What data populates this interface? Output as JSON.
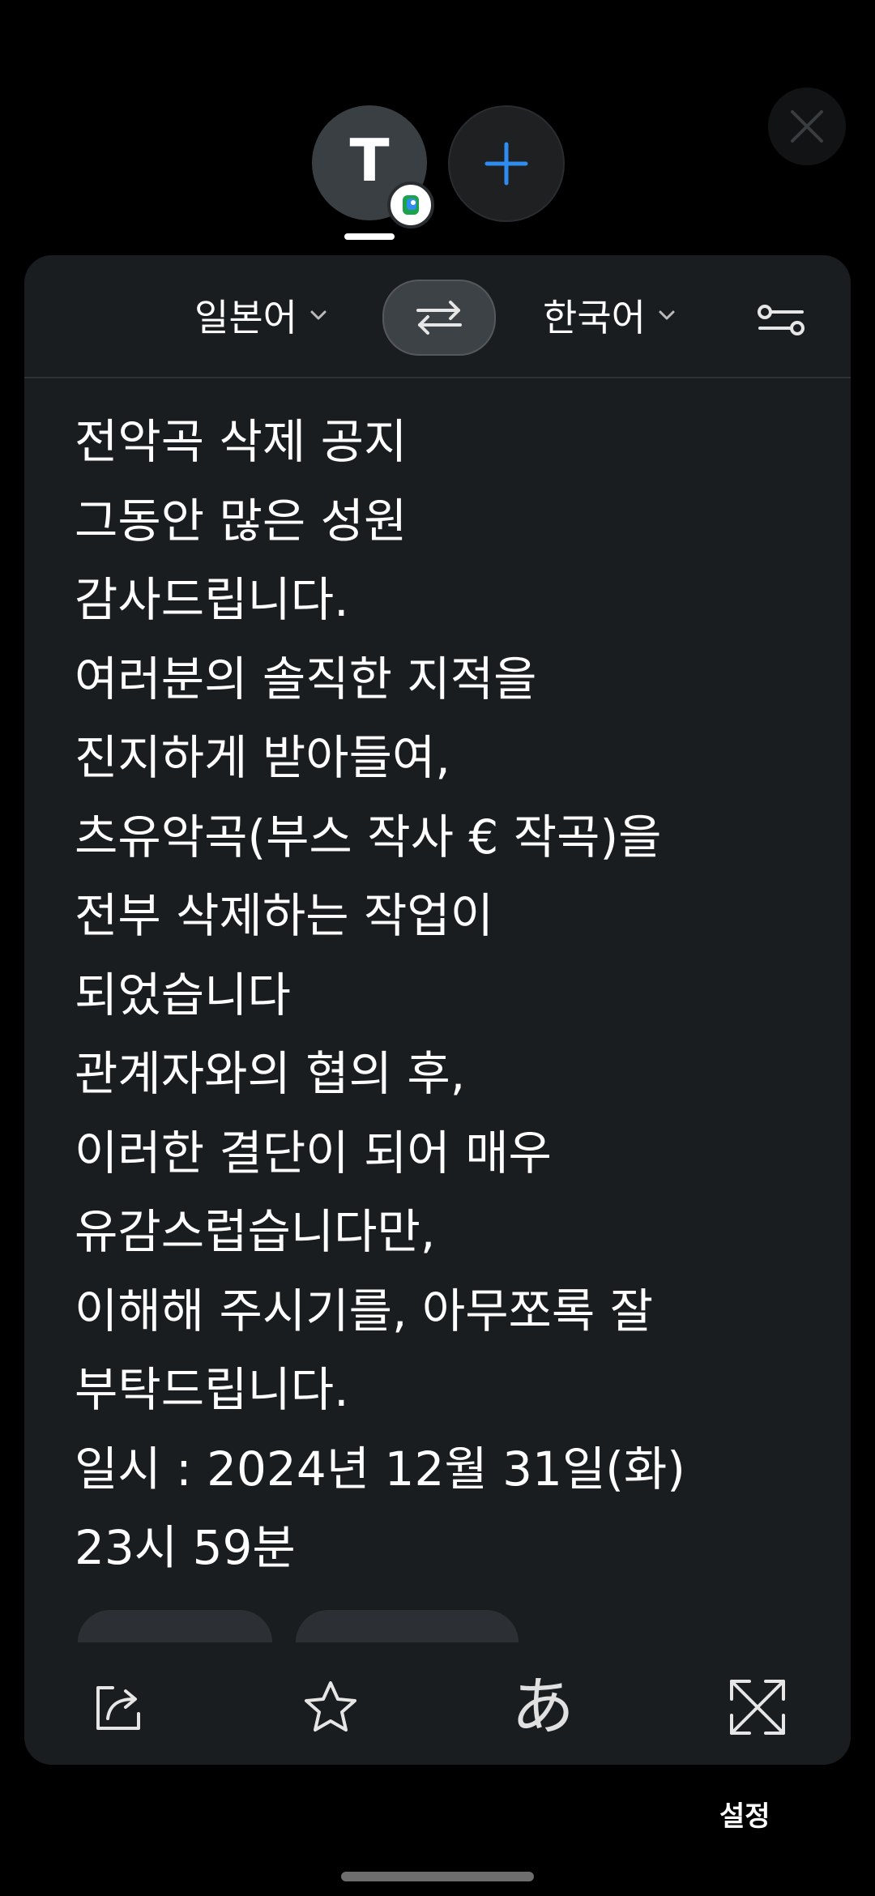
{
  "tabs": {
    "active_letter": "T"
  },
  "language_bar": {
    "source_language": "일본어",
    "target_language": "한국어"
  },
  "translation": {
    "lines": [
      "전악곡 삭제 공지",
      "그동안 많은 성원",
      "감사드립니다.",
      "여러분의 솔직한 지적을",
      "진지하게 받아들여,",
      "츠유악곡(부스 작사 € 작곡)을",
      "전부 삭제하는 작업이",
      "되었습니다",
      "관계자와의 협의 후,",
      "이러한 결단이 되어 매우",
      "유감스럽습니다만,",
      "이해해 주시기를, 아무쪼록 잘",
      "부탁드립니다.",
      "일시 : 2024년 12월 31일(화)",
      "23시 59분"
    ]
  },
  "bottom_bar": {
    "hiragana_label": "あ"
  },
  "footer": {
    "settings_label": "설정"
  },
  "icons": {
    "tab_add": "plus-icon",
    "close": "close-icon",
    "swap": "swap-arrows-icon",
    "settings": "sliders-icon",
    "share": "share-icon",
    "favorite": "star-icon",
    "expand": "expand-icon"
  },
  "colors": {
    "background": "#000000",
    "card": "#1a1d20",
    "accent_plus": "#2f8cf0",
    "text": "#ffffff"
  }
}
